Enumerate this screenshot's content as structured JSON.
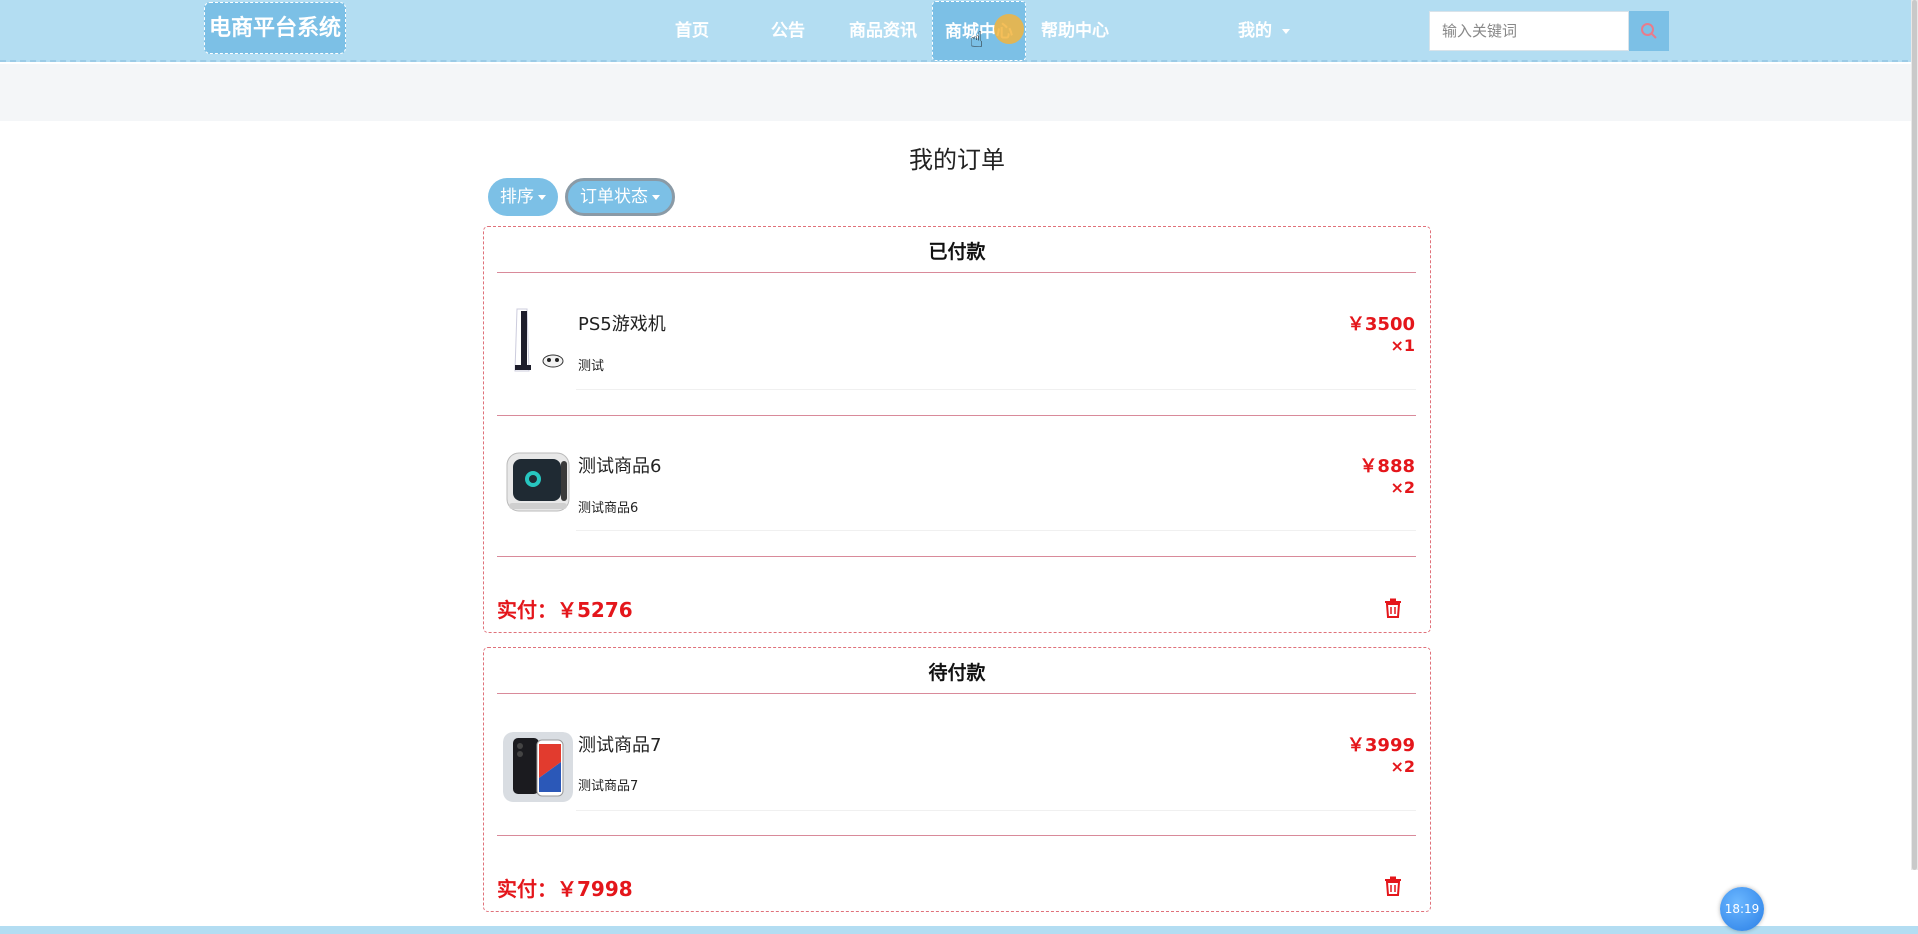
{
  "header": {
    "brand": "电商平台系统",
    "nav": [
      {
        "label": "首页"
      },
      {
        "label": "公告"
      },
      {
        "label": "商品资讯"
      },
      {
        "label": "商城中心"
      },
      {
        "label": "帮助中心"
      },
      {
        "label": "我的"
      }
    ],
    "search_placeholder": "输入关键词"
  },
  "page": {
    "title": "我的订单",
    "filters": [
      {
        "label": "排序"
      },
      {
        "label": "订单状态"
      }
    ]
  },
  "orders": [
    {
      "status": "已付款",
      "items": [
        {
          "name": "PS5游戏机",
          "desc": "测试",
          "price": "￥3500",
          "qty": "×1",
          "image": "ps5-console-image"
        },
        {
          "name": "测试商品6",
          "desc": "测试商品6",
          "price": "￥888",
          "qty": "×2",
          "image": "gaming-pc-image"
        }
      ],
      "total": "实付：￥5276"
    },
    {
      "status": "待付款",
      "items": [
        {
          "name": "测试商品7",
          "desc": "测试商品7",
          "price": "￥3999",
          "qty": "×2",
          "image": "smartphone-image"
        }
      ],
      "total": "实付：￥7998"
    }
  ],
  "clock": "18:19",
  "icons": {
    "search": "search-icon",
    "delete": "trash-icon"
  },
  "colors": {
    "navbar": "#b3ddf2",
    "accent": "#7cc0e6",
    "price": "#e4161b",
    "card_border": "#e0717a"
  }
}
